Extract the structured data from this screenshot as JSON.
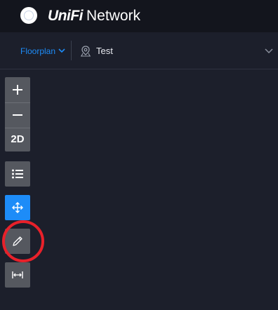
{
  "header": {
    "brand_unifi": "UniFi",
    "brand_network": "Network"
  },
  "subheader": {
    "floorplan_label": "Floorplan",
    "site_name": "Test"
  },
  "toolbar": {
    "zoom_in_icon": "plus-icon",
    "zoom_out_icon": "minus-icon",
    "view_mode_label": "2D",
    "list_icon": "list-icon",
    "move_icon": "move-arrows-icon",
    "draw_icon": "pencil-icon",
    "measure_icon": "measure-width-icon"
  },
  "colors": {
    "accent": "#1d8cf8",
    "header_bg": "#13151d",
    "canvas_bg": "#1c1f2b",
    "button_bg": "#55585f",
    "highlight": "#e8212a"
  }
}
